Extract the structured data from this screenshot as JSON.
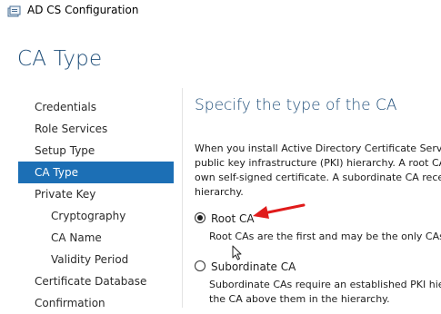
{
  "window": {
    "title": "AD CS Configuration",
    "icon": "server-config-icon"
  },
  "page": {
    "title": "CA Type"
  },
  "nav": {
    "items": [
      {
        "label": "Credentials",
        "level": 0,
        "active": false
      },
      {
        "label": "Role Services",
        "level": 0,
        "active": false
      },
      {
        "label": "Setup Type",
        "level": 0,
        "active": false
      },
      {
        "label": "CA Type",
        "level": 0,
        "active": true
      },
      {
        "label": "Private Key",
        "level": 0,
        "active": false
      },
      {
        "label": "Cryptography",
        "level": 1,
        "active": false
      },
      {
        "label": "CA Name",
        "level": 1,
        "active": false
      },
      {
        "label": "Validity Period",
        "level": 1,
        "active": false
      },
      {
        "label": "Certificate Database",
        "level": 0,
        "active": false
      },
      {
        "label": "Confirmation",
        "level": 0,
        "active": false
      }
    ]
  },
  "content": {
    "heading": "Specify the type of the CA",
    "description_lines": [
      "When you install Active Directory Certificate Service",
      "public key infrastructure (PKI) hierarchy. A root CA is",
      "own self-signed certificate. A subordinate CA receiv",
      "hierarchy."
    ],
    "options": [
      {
        "label": "Root CA",
        "checked": true,
        "description_lines": [
          "Root CAs are the first and may be the only CAs c"
        ]
      },
      {
        "label": "Subordinate CA",
        "checked": false,
        "description_lines": [
          "Subordinate CAs require an established PKI hiera",
          "the CA above them in the hierarchy."
        ]
      }
    ]
  },
  "annotation": {
    "arrow_color": "#e01b1b",
    "icon": "red-arrow-icon"
  },
  "colors": {
    "accent": "#1c6fb5",
    "title": "#1f4e79"
  }
}
